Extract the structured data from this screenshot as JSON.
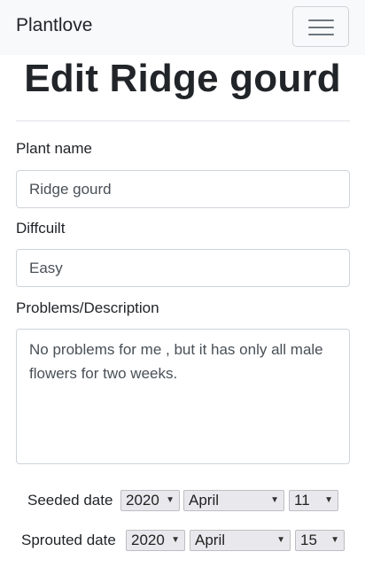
{
  "navbar": {
    "brand": "Plantlove",
    "toggle_icon": "hamburger-menu-icon"
  },
  "page": {
    "title": "Edit Ridge gourd"
  },
  "form": {
    "plant_name_label": "Plant name",
    "plant_name_value": "Ridge gourd",
    "difficulty_label": "Diffcuilt",
    "difficulty_value": "Easy",
    "description_label": "Problems/Description",
    "description_value": "No problems for me , but it has only all male flowers for two weeks.",
    "seeded": {
      "label": "Seeded date",
      "year": "2020",
      "month": "April",
      "day": "11"
    },
    "sprouted": {
      "label": "Sprouted date",
      "year": "2020",
      "month": "April",
      "day": "15"
    }
  },
  "icons": {
    "select_arrow": "dropdown-arrow-icon"
  },
  "colors": {
    "navbar_bg": "#f8f9fa",
    "text": "#212529",
    "input_border": "#ced4da"
  }
}
